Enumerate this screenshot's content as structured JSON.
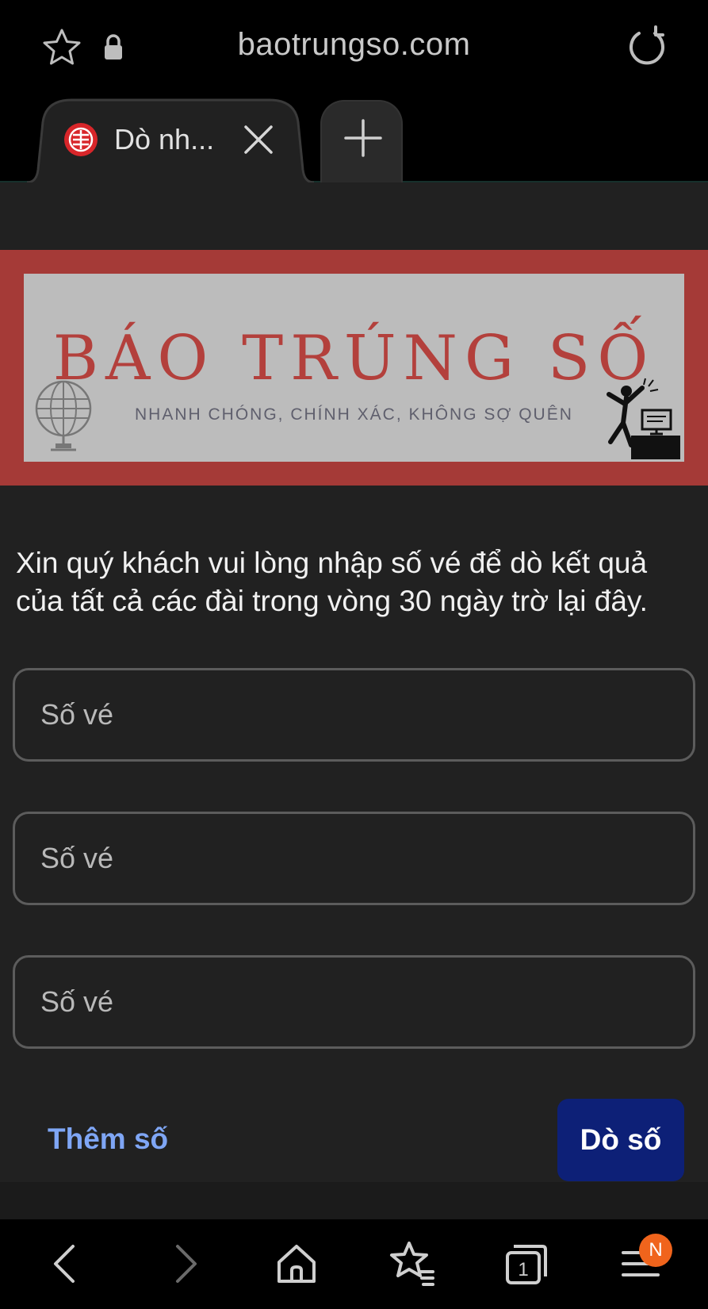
{
  "browser": {
    "url": "baotrungso.com",
    "tab_title": "Dò nh...",
    "badge": "N",
    "accent_color": "#f0641c"
  },
  "banner": {
    "title": "BÁO TRÚNG SỐ",
    "tagline": "NHANH CHÓNG, CHÍNH XÁC, KHÔNG SỢ QUÊN",
    "border_color": "#a53a37",
    "title_color": "#b3403c"
  },
  "form": {
    "instruction": "Xin quý khách vui lòng nhập số vé để dò kết quả của tất cả các đài trong vòng 30 ngày trờ lại đây.",
    "inputs": [
      {
        "placeholder": "Số vé",
        "value": ""
      },
      {
        "placeholder": "Số vé",
        "value": ""
      },
      {
        "placeholder": "Số vé",
        "value": ""
      }
    ],
    "add_label": "Thêm số",
    "search_label": "Dò số",
    "button_color": "#0d2077",
    "link_color": "#7fa6f5"
  },
  "nav": {
    "tab_count": "1",
    "items": [
      "back-icon",
      "forward-icon",
      "home-icon",
      "bookmarks-icon",
      "tabs-icon",
      "menu-icon"
    ]
  }
}
